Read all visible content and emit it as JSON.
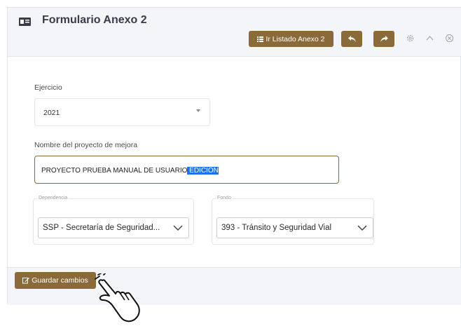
{
  "header": {
    "title": "Formulario Anexo 2",
    "list_button_label": "Ir Listado Anexo 2",
    "accent_color": "#8b6a3a"
  },
  "form": {
    "ejercicio": {
      "label": "Ejercicio",
      "value": "2021"
    },
    "nombre": {
      "label": "Nombre del proyecto de mejora",
      "value_prefix": "PROYECTO PRUEBA MANUAL DE USUARIO",
      "value_selected": " EDICIÓN"
    },
    "dependencia": {
      "legend": "Dependencia",
      "value": "SSP - Secretaría de Seguridad..."
    },
    "fondo": {
      "legend": "Fondo",
      "value": "393 - Tránsito y Seguridad Vial"
    }
  },
  "footer": {
    "save_label": "Guardar cambios"
  },
  "icons": {
    "header": "id-card-icon",
    "list": "list-icon",
    "back": "reply-icon",
    "forward": "share-icon",
    "settings": "gear-icon",
    "collapse": "chevron-up-icon",
    "close": "close-circle-icon",
    "save": "edit-icon",
    "cursor": "hand-pointer-icon"
  }
}
